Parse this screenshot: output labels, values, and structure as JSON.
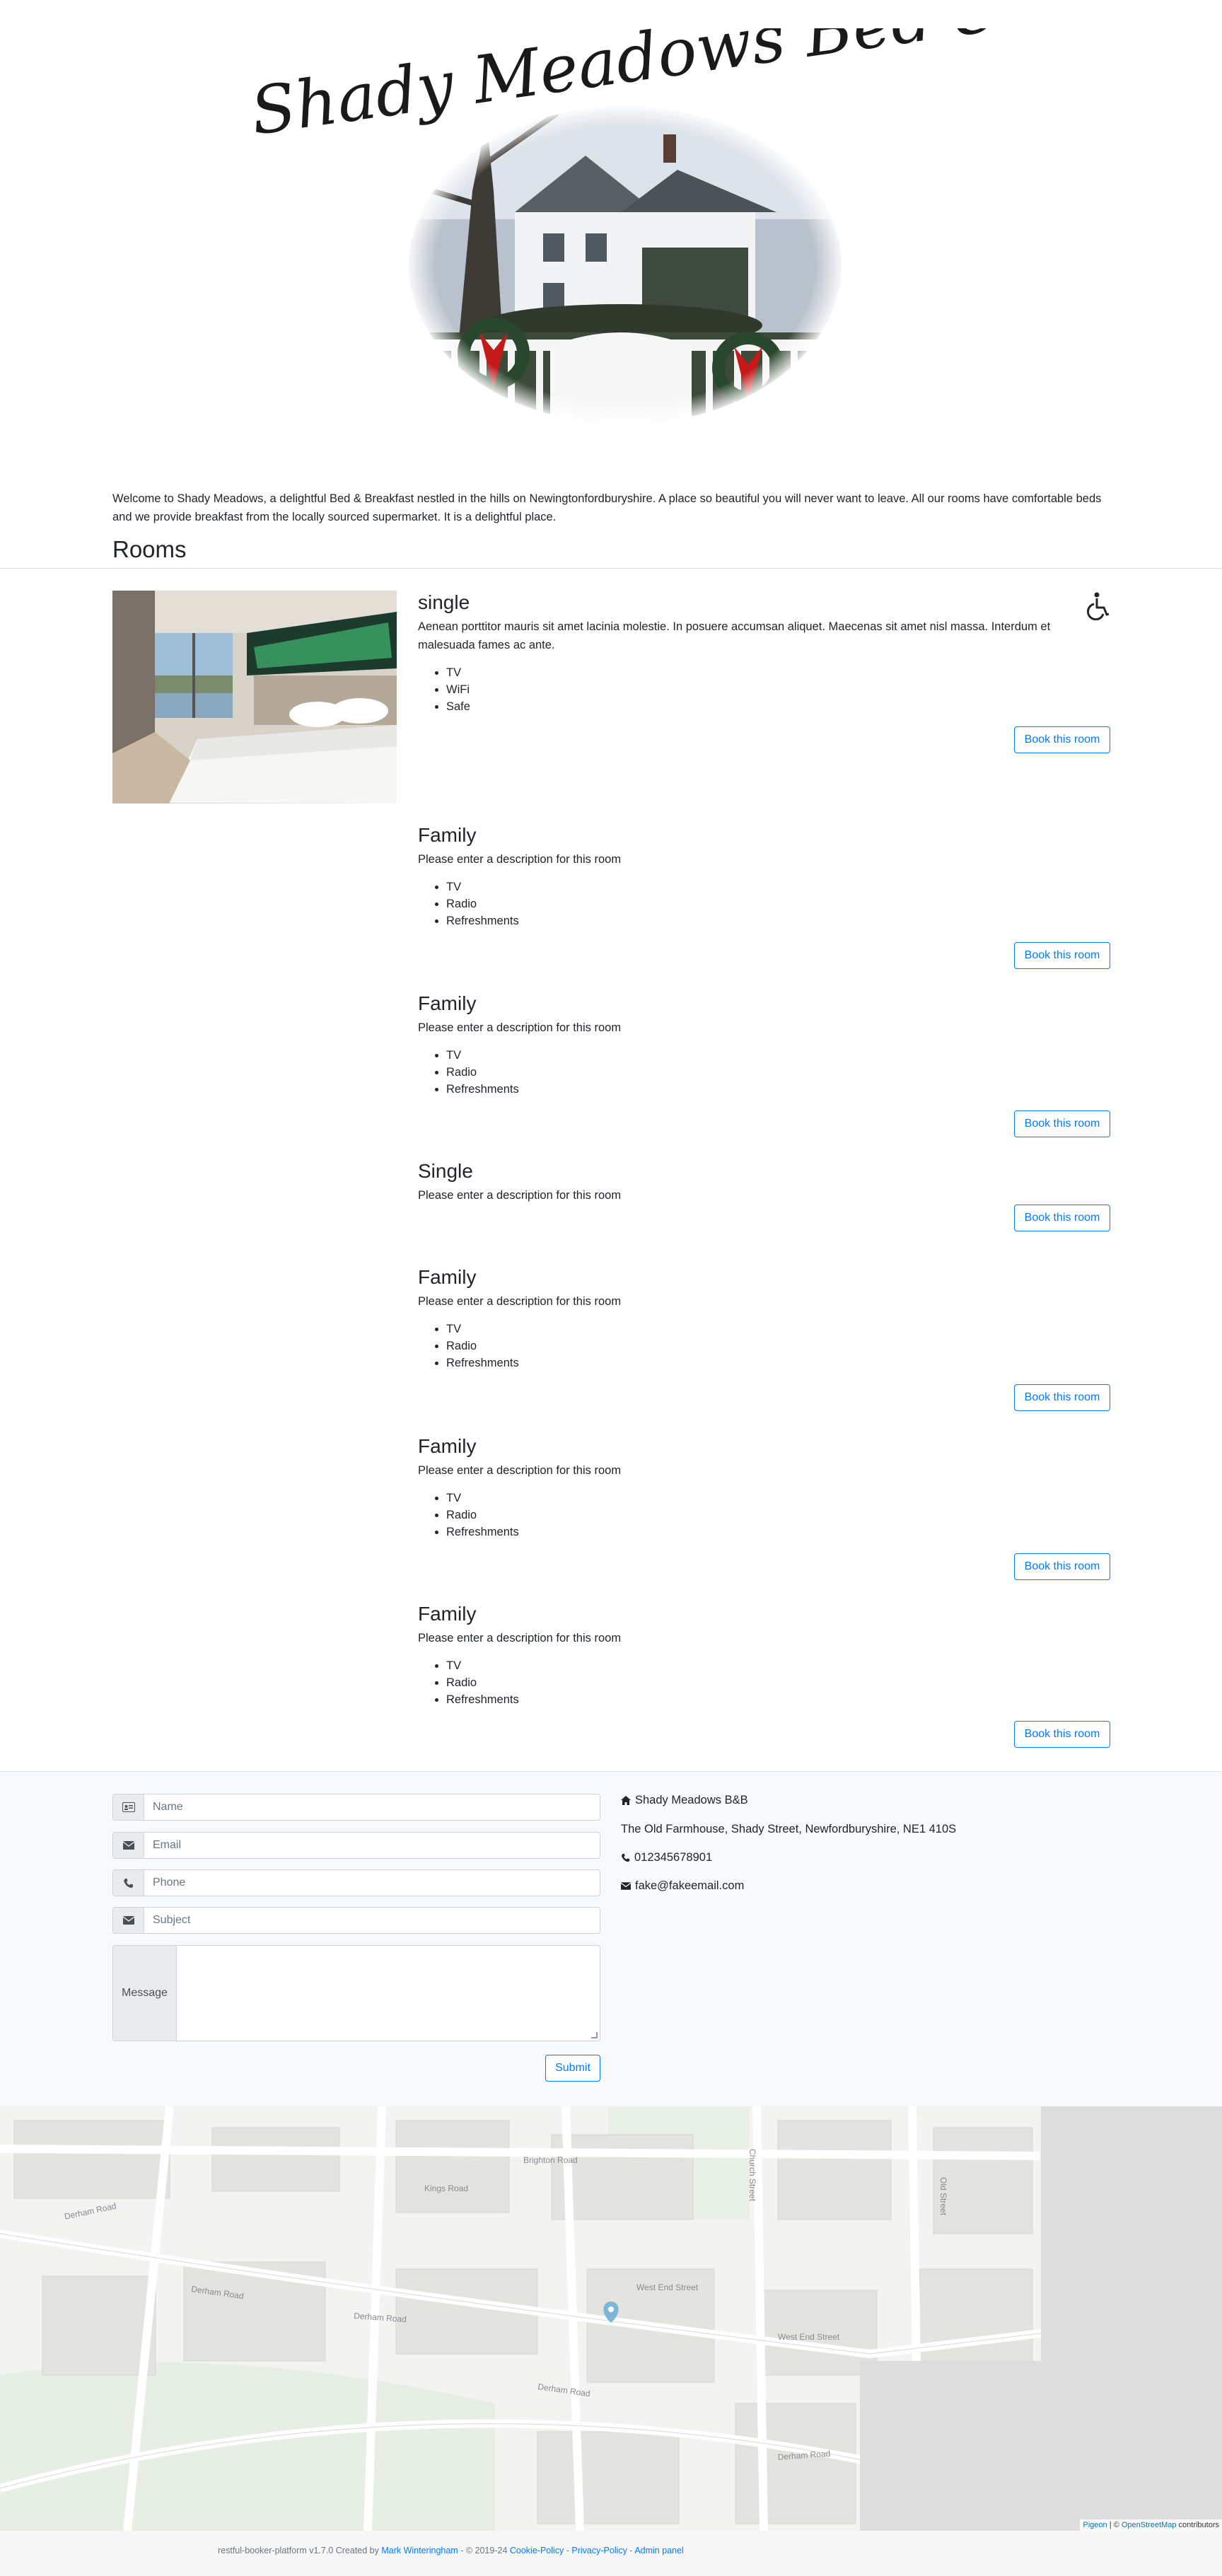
{
  "header": {
    "logo_text": "Shady Meadows Bed & Breakfast"
  },
  "intro": {
    "text": "Welcome to Shady Meadows, a delightful Bed & Breakfast nestled in the hills on Newingtonfordburyshire. A place so beautiful you will never want to leave. All our rooms have comfortable beds and we provide breakfast from the locally sourced supermarket. It is a delightful place."
  },
  "rooms_heading": "Rooms",
  "rooms": [
    {
      "name": "single",
      "description": "Aenean porttitor mauris sit amet lacinia molestie. In posuere accumsan aliquet. Maecenas sit amet nisl massa. Interdum et malesuada fames ac ante.",
      "features": [
        "TV",
        "WiFi",
        "Safe"
      ],
      "accessible": true,
      "book_label": "Book this room"
    },
    {
      "name": "Family",
      "description": "Please enter a description for this room",
      "features": [
        "TV",
        "Radio",
        "Refreshments"
      ],
      "book_label": "Book this room"
    },
    {
      "name": "Family",
      "description": "Please enter a description for this room",
      "features": [
        "TV",
        "Radio",
        "Refreshments"
      ],
      "book_label": "Book this room"
    },
    {
      "name": "Single",
      "description": "Please enter a description for this room",
      "features": [],
      "book_label": "Book this room"
    },
    {
      "name": "Family",
      "description": "Please enter a description for this room",
      "features": [
        "TV",
        "Radio",
        "Refreshments"
      ],
      "book_label": "Book this room"
    },
    {
      "name": "Family",
      "description": "Please enter a description for this room",
      "features": [
        "TV",
        "Radio",
        "Refreshments"
      ],
      "book_label": "Book this room"
    },
    {
      "name": "Family",
      "description": "Please enter a description for this room",
      "features": [
        "TV",
        "Radio",
        "Refreshments"
      ],
      "book_label": "Book this room"
    }
  ],
  "contact_form": {
    "name_placeholder": "Name",
    "email_placeholder": "Email",
    "phone_placeholder": "Phone",
    "subject_placeholder": "Subject",
    "message_label": "Message",
    "submit_label": "Submit",
    "icons": {
      "name": "id-card-icon",
      "email": "envelope-icon",
      "phone": "phone-icon",
      "subject": "envelope-icon"
    }
  },
  "contact_info": {
    "business_name": "Shady Meadows B&B",
    "address": "The Old Farmhouse, Shady Street, Newfordburyshire, NE1 410S",
    "phone": "012345678901",
    "email": "fake@fakeemail.com"
  },
  "map": {
    "streets": [
      "Derham Road",
      "Derham Road",
      "Derham Road",
      "Derham Road",
      "Derham Road",
      "Kings Road",
      "Brighton Road",
      "West End Street",
      "West End Street",
      "Old Street",
      "Church Street"
    ],
    "attribution": {
      "pigeon": "Pigeon",
      "separator": " | © ",
      "osm": "OpenStreetMap",
      "suffix": " contributors"
    }
  },
  "footer": {
    "prefix": "restful-booker-platform v1.7.0 Created by ",
    "author": "Mark Winteringham",
    "copyright": " - © 2019-24 ",
    "cookie": "Cookie-Policy",
    "sep1": " - ",
    "privacy": "Privacy-Policy",
    "sep2": " - ",
    "admin": "Admin panel"
  },
  "colors": {
    "primary": "#007bff",
    "text": "#212529",
    "contact_bg": "#f7f9fc",
    "map_bg": "#f2f2f0"
  }
}
